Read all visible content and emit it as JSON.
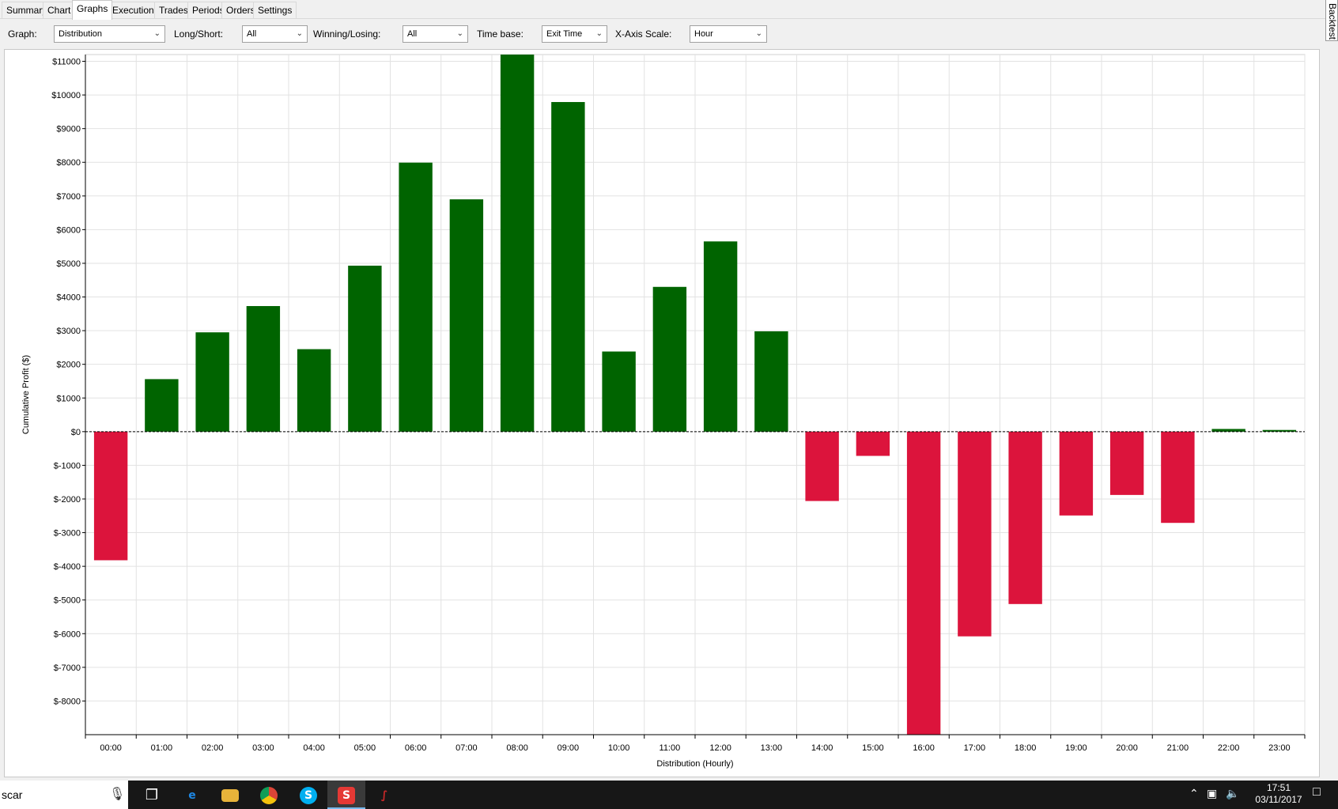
{
  "tabs": [
    "Summary",
    "Chart",
    "Graphs",
    "Executions",
    "Trades",
    "Periods",
    "Orders",
    "Settings"
  ],
  "active_tab": "Graphs",
  "side_tab_label": "Backtest",
  "toolbar": {
    "graph_label": "Graph:",
    "graph_value": "Distribution",
    "longshort_label": "Long/Short:",
    "longshort_value": "All",
    "winlose_label": "Winning/Losing:",
    "winlose_value": "All",
    "timebase_label": "Time base:",
    "timebase_value": "Exit Time",
    "xscale_label": "X-Axis Scale:",
    "xscale_value": "Hour"
  },
  "chart_data": {
    "type": "bar",
    "xlabel": "Distribution (Hourly)",
    "ylabel": "Cumulative Profit ($)",
    "categories": [
      "00:00",
      "01:00",
      "02:00",
      "03:00",
      "04:00",
      "05:00",
      "06:00",
      "07:00",
      "08:00",
      "09:00",
      "10:00",
      "11:00",
      "12:00",
      "13:00",
      "14:00",
      "15:00",
      "16:00",
      "17:00",
      "18:00",
      "19:00",
      "20:00",
      "21:00",
      "22:00",
      "23:00"
    ],
    "values": [
      -3820,
      1560,
      2950,
      3730,
      2450,
      4930,
      7990,
      6900,
      11200,
      9790,
      2380,
      4300,
      5650,
      2980,
      -2060,
      -720,
      -9000,
      -6080,
      -5120,
      -2490,
      -1880,
      -2710,
      80,
      50
    ],
    "ylim": [
      -9000,
      11200
    ],
    "yticks": [
      11000,
      10000,
      9000,
      8000,
      7000,
      6000,
      5000,
      4000,
      3000,
      2000,
      1000,
      0,
      -1000,
      -2000,
      -3000,
      -4000,
      -5000,
      -6000,
      -7000,
      -8000
    ],
    "ytick_labels": [
      "$11000",
      "$10000",
      "$9000",
      "$8000",
      "$7000",
      "$6000",
      "$5000",
      "$4000",
      "$3000",
      "$2000",
      "$1000",
      "$0",
      "$-1000",
      "$-2000",
      "$-3000",
      "$-4000",
      "$-5000",
      "$-6000",
      "$-7000",
      "$-8000"
    ],
    "grid": true,
    "positive_color": "#006400",
    "negative_color": "#dc143c"
  },
  "taskbar": {
    "search_text": "scar",
    "apps": [
      "task-view-icon",
      "edge-icon",
      "file-explorer-icon",
      "chrome-icon",
      "skype-icon",
      "s-app-icon",
      "ninjatrader-icon"
    ],
    "time": "17:51",
    "date": "03/11/2017"
  }
}
